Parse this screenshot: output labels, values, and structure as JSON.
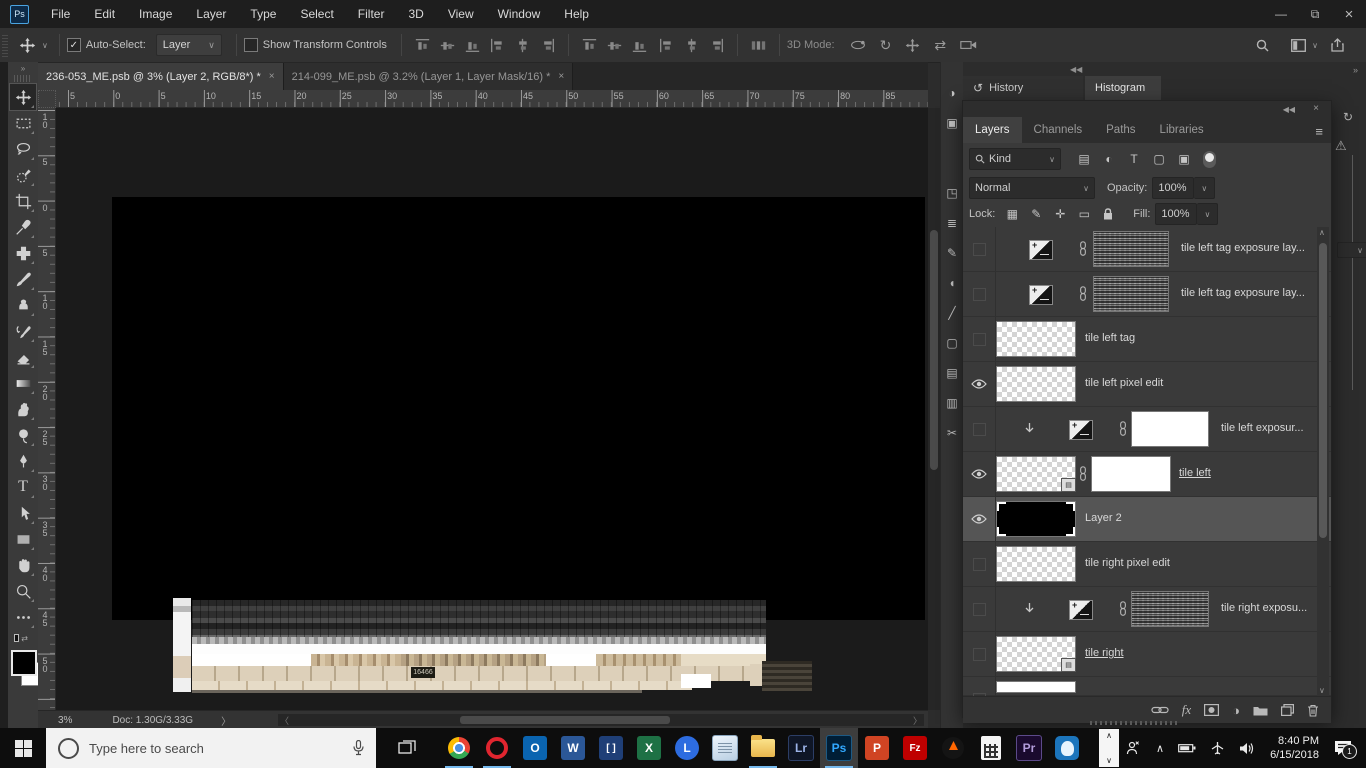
{
  "window": {
    "minimize": "—",
    "restore": "⧉",
    "close": "×",
    "collapse_left": "◀◀",
    "collapse_right": "»",
    "float_collapse": "»",
    "float_close": "×"
  },
  "menu": {
    "items": [
      "File",
      "Edit",
      "Image",
      "Layer",
      "Type",
      "Select",
      "Filter",
      "3D",
      "View",
      "Window",
      "Help"
    ],
    "logo": "Ps"
  },
  "options_bar": {
    "tool_icon": "move-tool-icon",
    "auto_select_label": "Auto-Select:",
    "auto_select_checked": true,
    "auto_select_value": "Layer",
    "show_transform_label": "Show Transform Controls",
    "show_transform_checked": false,
    "align_icons": [
      "align-top-edges-icon",
      "align-vertical-centers-icon",
      "align-bottom-edges-icon",
      "align-left-edges-icon",
      "align-horizontal-centers-icon",
      "align-right-edges-icon"
    ],
    "distribute_icons_v": [
      "distribute-top-edges-icon",
      "distribute-vertical-centers-icon",
      "distribute-bottom-edges-icon"
    ],
    "distribute_icons_h": [
      "distribute-left-edges-icon",
      "distribute-horizontal-centers-icon",
      "distribute-right-edges-icon"
    ],
    "spacing_icon": "distribute-spacing-icon",
    "mode_label": "3D Mode:",
    "mode_icons": [
      "3d-orbit-icon",
      "3d-roll-icon",
      "3d-pan-icon",
      "3d-slide-icon",
      "3d-dolly-icon"
    ],
    "right_icons": [
      "search-icon",
      "workspace-icon",
      "share-icon"
    ]
  },
  "tabs": [
    {
      "title": "236-053_ME.psb @ 3% (Layer 2, RGB/8*) *",
      "close": "×",
      "active": true
    },
    {
      "title": "214-099_ME.psb @ 3.2% (Layer 1, Layer Mask/16) *",
      "close": "×",
      "active": false
    }
  ],
  "toolbar": {
    "tools": [
      "move-tool",
      "rectangular-marquee-tool",
      "lasso-tool",
      "quick-selection-tool",
      "crop-tool",
      "eyedropper-tool",
      "spot-healing-brush-tool",
      "brush-tool",
      "clone-stamp-tool",
      "history-brush-tool",
      "eraser-tool",
      "gradient-tool",
      "smudge-tool",
      "dodge-tool",
      "pen-tool",
      "type-tool",
      "path-selection-tool",
      "rectangle-tool",
      "hand-tool",
      "zoom-tool",
      "edit-toolbar"
    ],
    "selected_index": 0,
    "foreground_color": "#000000",
    "background_color": "#ffffff"
  },
  "rulers": {
    "horizontal": [
      "5",
      "0",
      "5",
      "10",
      "15",
      "20",
      "25",
      "30",
      "35",
      "40",
      "45",
      "50",
      "55",
      "60",
      "65",
      "70",
      "75",
      "80",
      "85"
    ],
    "vertical": [
      "10",
      "5",
      "0",
      "5",
      "10",
      "15",
      "20",
      "25",
      "30",
      "35",
      "40",
      "45",
      "50"
    ]
  },
  "canvas": {
    "artwork_label": "16466"
  },
  "status_bar": {
    "zoom": "3%",
    "doc": "Doc: 1.30G/3.33G",
    "expander": "〉"
  },
  "panels": {
    "history_tab": "History",
    "histogram_tab": "Histogram",
    "dock_icons": [
      "adjustments-panel-icon",
      "3d-panel-icon",
      "color-panel-icon",
      "swatches-panel-icon",
      "brushes-panel-icon",
      "styles-panel-icon",
      "clone-source-panel-icon",
      "shapes-panel-icon",
      "character-panel-icon",
      "paragraph-panel-icon",
      "timeline-panel-icon"
    ],
    "histogram_refresh_icon": "refresh-icon",
    "histogram_warning_icon": "warning-icon",
    "layers_group": {
      "tabs": [
        "Layers",
        "Channels",
        "Paths",
        "Libraries"
      ],
      "active_tab": "Layers",
      "menu_icon": "panel-menu-icon",
      "filter": {
        "label": "Kind",
        "icons": [
          "pixel-filter-icon",
          "adjustment-filter-icon",
          "type-filter-icon",
          "shape-filter-icon",
          "smart-filter-icon"
        ],
        "toggle_icon": "filter-toggle"
      },
      "blend_mode": "Normal",
      "opacity_label": "Opacity:",
      "opacity_value": "100%",
      "lock_label": "Lock:",
      "lock_icons": [
        "lock-transparent-icon",
        "lock-paint-icon",
        "lock-position-icon",
        "lock-artboard-icon",
        "lock-all-icon"
      ],
      "fill_label": "Fill:",
      "fill_value": "100%",
      "layers": [
        {
          "name": "tile left tag exposure lay...",
          "visible": false,
          "kind": "adj",
          "clipped": false,
          "chain": true,
          "mask": "noise"
        },
        {
          "name": "tile left tag exposure lay...",
          "visible": false,
          "kind": "adj",
          "clipped": false,
          "chain": true,
          "mask": "noise"
        },
        {
          "name": "tile left tag",
          "visible": false,
          "kind": "pixel",
          "thumb": "checker"
        },
        {
          "name": "tile left pixel edit",
          "visible": true,
          "kind": "pixel",
          "thumb": "checker"
        },
        {
          "name": "tile left exposur...",
          "visible": false,
          "kind": "adj",
          "clipped": true,
          "chain": true,
          "mask": "white"
        },
        {
          "name": "tile left",
          "visible": true,
          "kind": "smart",
          "thumb": "checker",
          "chain": true,
          "mask": "white",
          "underline": true
        },
        {
          "name": "Layer 2",
          "visible": true,
          "kind": "pixel",
          "thumb": "black",
          "selected": true
        },
        {
          "name": "tile right pixel edit",
          "visible": false,
          "kind": "pixel",
          "thumb": "checker"
        },
        {
          "name": "tile right exposu...",
          "visible": false,
          "kind": "adj",
          "clipped": true,
          "chain": true,
          "mask": "noise"
        },
        {
          "name": "tile right",
          "visible": false,
          "kind": "smart",
          "thumb": "checker",
          "underline": true
        },
        {
          "name": "",
          "visible": false,
          "kind": "partial",
          "thumb": "white"
        }
      ],
      "bottom_icons": [
        "link-layers-icon",
        "layer-style-icon",
        "add-layer-mask-icon",
        "new-adjustment-layer-icon",
        "new-group-icon",
        "new-layer-icon",
        "delete-layer-icon"
      ]
    }
  },
  "taskbar": {
    "start_icon": "windows-start-icon",
    "search_placeholder": "Type here to search",
    "search_icons": [
      "cortana-icon",
      "microphone-icon"
    ],
    "task_view_icon": "task-view-icon",
    "apps": [
      {
        "name": "chrome",
        "label": "",
        "running": true,
        "active": false
      },
      {
        "name": "opera",
        "label": "O",
        "running": true,
        "active": false
      },
      {
        "name": "outlook",
        "label": "O",
        "running": false,
        "active": false
      },
      {
        "name": "word",
        "label": "W",
        "running": false,
        "active": false
      },
      {
        "name": "brackets",
        "label": "[]",
        "running": false,
        "active": false
      },
      {
        "name": "excel",
        "label": "X",
        "running": false,
        "active": false
      },
      {
        "name": "app-l",
        "label": "L",
        "running": false,
        "active": false
      },
      {
        "name": "notepad",
        "label": "",
        "running": false,
        "active": false
      },
      {
        "name": "explorer",
        "label": "",
        "running": true,
        "active": false
      },
      {
        "name": "lightroom",
        "label": "Lr",
        "running": false,
        "active": false
      },
      {
        "name": "photoshop",
        "label": "Ps",
        "running": true,
        "active": true
      },
      {
        "name": "powerpoint",
        "label": "P",
        "running": false,
        "active": false
      },
      {
        "name": "filezilla",
        "label": "Fz",
        "running": false,
        "active": false
      },
      {
        "name": "app-orange",
        "label": "",
        "running": false,
        "active": false
      },
      {
        "name": "calculator",
        "label": "",
        "running": false,
        "active": false
      },
      {
        "name": "premiere",
        "label": "Pr",
        "running": false,
        "active": false
      },
      {
        "name": "app-head",
        "label": "",
        "running": false,
        "active": false
      }
    ],
    "tray_icons": [
      "scroll-arrows-icon",
      "people-icon",
      "hidden-icons-chevron",
      "battery-icon",
      "airplane-icon",
      "speaker-icon"
    ],
    "clock": {
      "time": "8:40 PM",
      "date": "6/15/2018"
    },
    "notification_icon": "notification-icon",
    "notification_badge": "1"
  }
}
